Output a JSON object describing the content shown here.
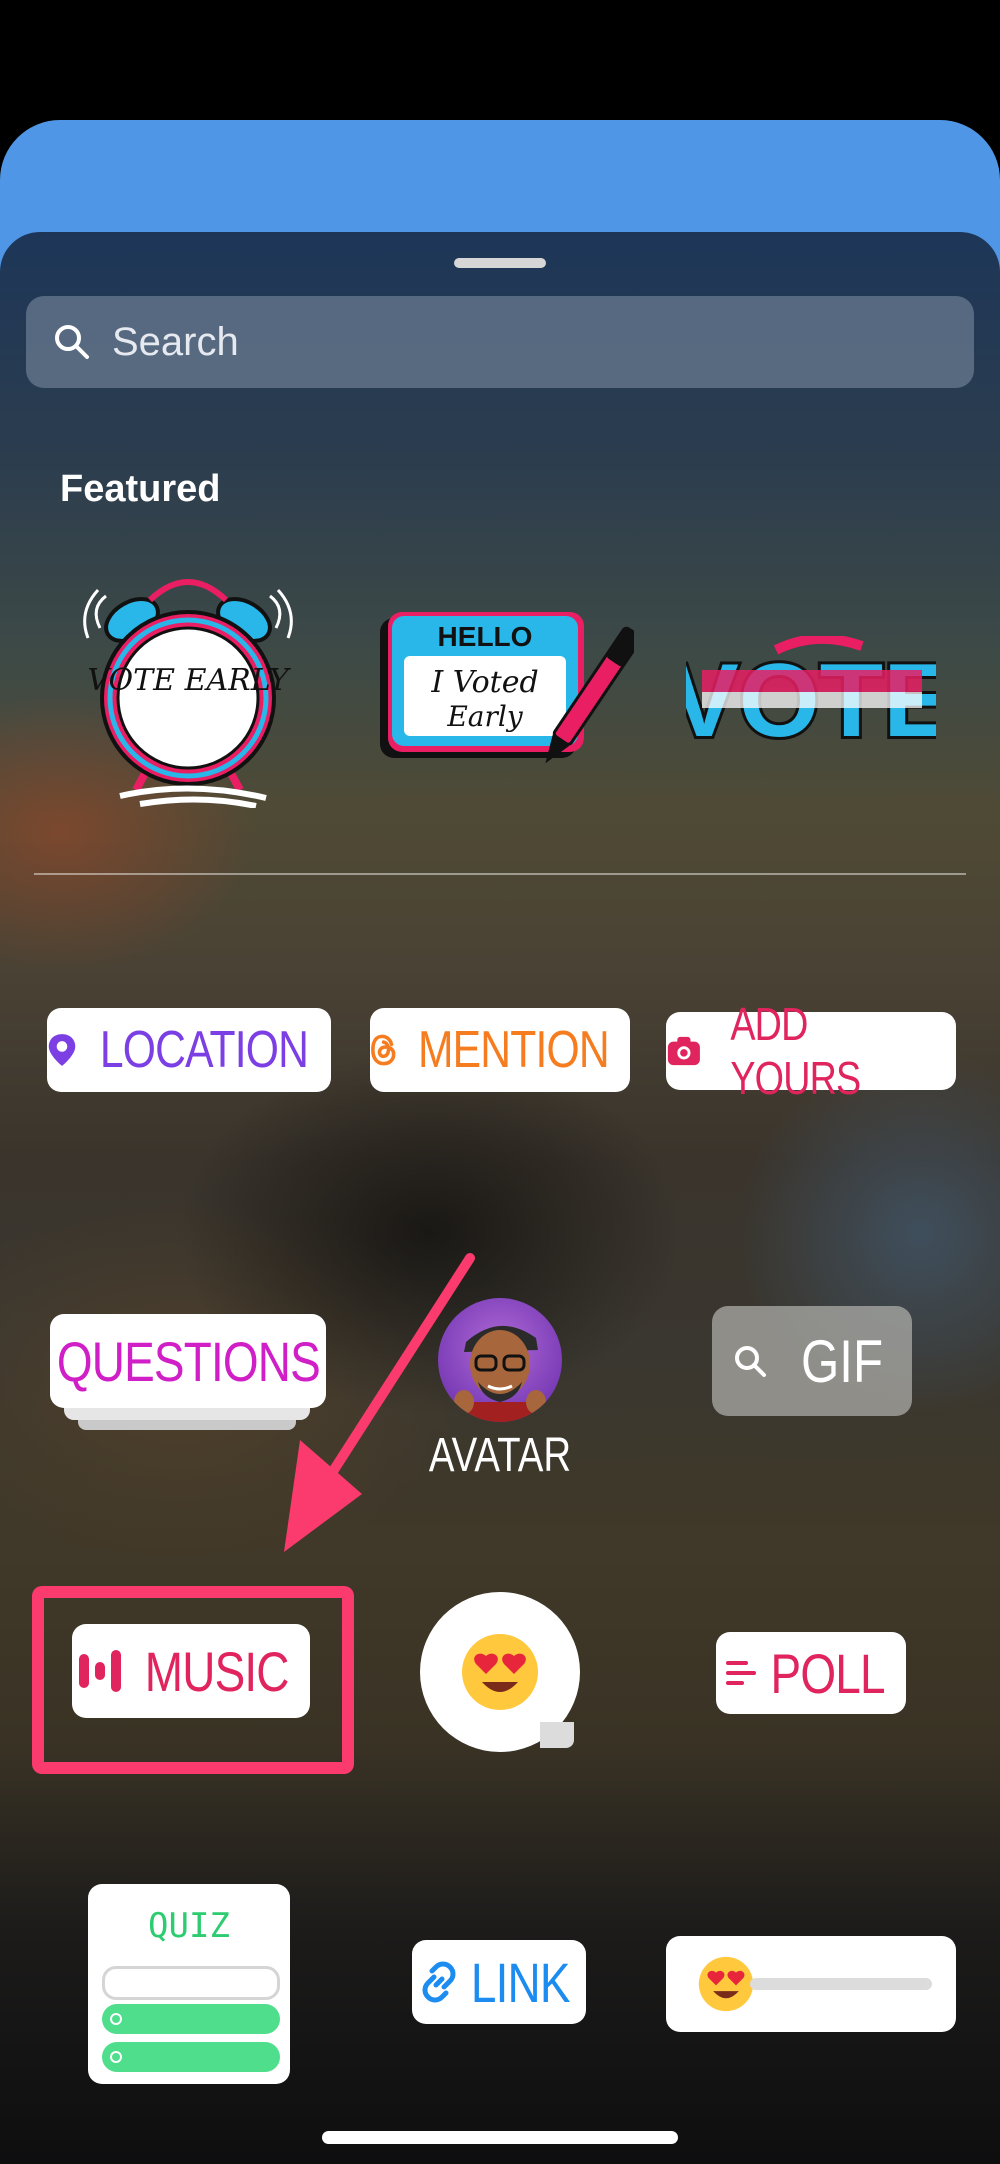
{
  "search": {
    "placeholder": "Search",
    "icon": "search-icon"
  },
  "featured": {
    "title": "Featured",
    "stickers": [
      {
        "name": "vote-early-clock-sticker",
        "text": "VOTE EARLY"
      },
      {
        "name": "hello-i-voted-early-sticker",
        "header": "HELLO",
        "line1": "I Voted",
        "line2": "Early"
      },
      {
        "name": "vote-sticker",
        "text": "VOTE"
      }
    ]
  },
  "stickers": {
    "location": "LOCATION",
    "mention": "MENTION",
    "add_yours": "ADD YOURS",
    "questions": "QUESTIONS",
    "avatar": "AVATAR",
    "gif": "GIF",
    "music": "MUSIC",
    "poll": "POLL",
    "quiz": "QUIZ",
    "link": "LINK"
  },
  "colors": {
    "location": "#7b3fe4",
    "mention": "#f57c1f",
    "add_yours": "#e0245e",
    "questions": "#d11fc8",
    "music": "#e0245e",
    "poll": "#e0245e",
    "quiz": "#2ecc71",
    "link": "#1d8cf0",
    "highlight": "#fb3a6d"
  }
}
